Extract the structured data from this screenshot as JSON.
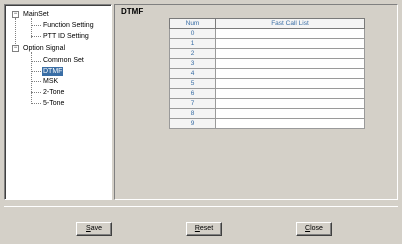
{
  "tree": {
    "nodes": [
      {
        "label": "MainSet",
        "expander": "−"
      },
      {
        "label": "Function Setting"
      },
      {
        "label": "PTT ID Setting"
      },
      {
        "label": "Option Signal",
        "expander": "−"
      },
      {
        "label": "Common Set"
      },
      {
        "label": "DTMF",
        "selected": true
      },
      {
        "label": "MSK"
      },
      {
        "label": "2-Tone"
      },
      {
        "label": "5-Tone"
      }
    ]
  },
  "panel": {
    "title": "DTMF"
  },
  "table": {
    "headers": [
      "Num",
      "Fast Call List"
    ],
    "rows": [
      {
        "num": "0",
        "value": ""
      },
      {
        "num": "1",
        "value": ""
      },
      {
        "num": "2",
        "value": ""
      },
      {
        "num": "3",
        "value": ""
      },
      {
        "num": "4",
        "value": ""
      },
      {
        "num": "5",
        "value": ""
      },
      {
        "num": "6",
        "value": ""
      },
      {
        "num": "7",
        "value": ""
      },
      {
        "num": "8",
        "value": ""
      },
      {
        "num": "9",
        "value": ""
      }
    ]
  },
  "buttons": {
    "save": {
      "accel": "S",
      "rest": "ave"
    },
    "reset": {
      "accel": "R",
      "rest": "eset"
    },
    "close": {
      "accel": "C",
      "rest": "lose"
    }
  },
  "colors": {
    "selection": "#3a6ea5",
    "header_text": "#3a6ea5",
    "background": "#d4d0c8"
  }
}
